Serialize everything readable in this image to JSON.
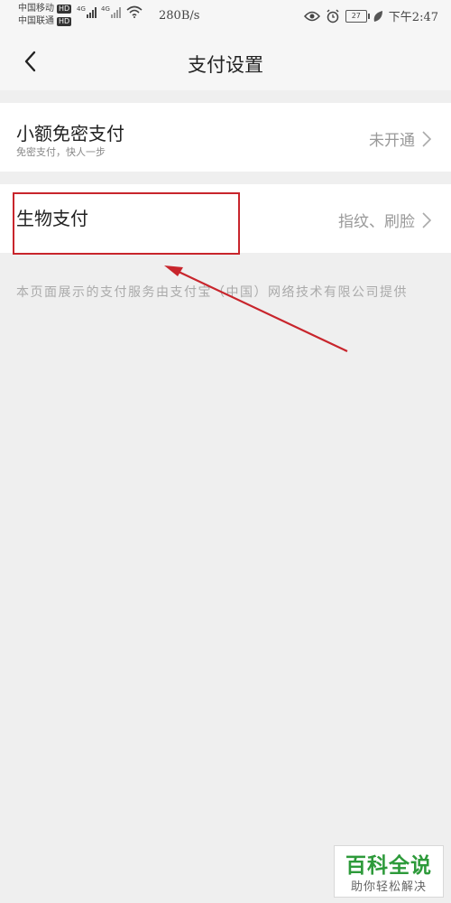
{
  "status_bar": {
    "carrier1": "中国移动",
    "carrier2": "中国联通",
    "hd_badge": "HD",
    "net_type": "4G",
    "net_speed": "280B/s",
    "battery_level": "27",
    "time": "下午2:47",
    "icons": [
      "eye-icon",
      "alarm-icon",
      "battery-icon",
      "leaf-icon",
      "wifi-icon",
      "signal-icon"
    ]
  },
  "nav": {
    "title": "支付设置",
    "back_icon": "chevron-left-icon"
  },
  "settings": [
    {
      "title": "小额免密支付",
      "subtitle": "免密支付，快人一步",
      "value": "未开通",
      "icon": "chevron-right-icon"
    },
    {
      "title": "生物支付",
      "value": "指纹、刷脸",
      "icon": "chevron-right-icon"
    }
  ],
  "footer_note": "本页面展示的支付服务由支付宝（中国）网络技术有限公司提供",
  "annotation_color": "#c8252c",
  "watermark": {
    "title": "百科全说",
    "subtitle": "助你轻松解决"
  }
}
